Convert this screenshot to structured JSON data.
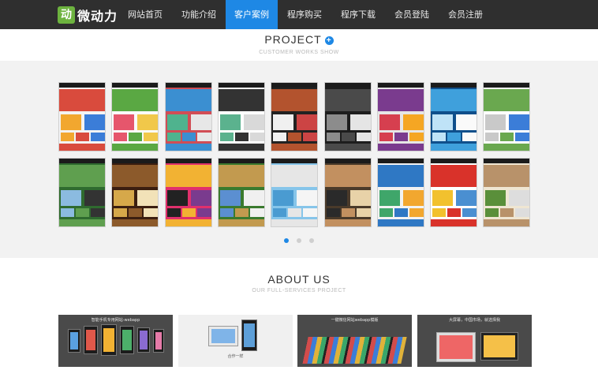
{
  "brand": {
    "logo_mark": "动",
    "logo_text": "微动力"
  },
  "nav": {
    "items": [
      "网站首页",
      "功能介绍",
      "客户案例",
      "程序购买",
      "程序下载",
      "会员登陆",
      "会员注册"
    ],
    "active_index": 2
  },
  "project": {
    "title": "PROJECT",
    "plus": "+",
    "subtitle": "CUSTOMER WORKS SHOW"
  },
  "gallery": {
    "rows": 2,
    "columns": 9,
    "slides": 3,
    "active_slide": 0
  },
  "about": {
    "title": "ABOUT US",
    "subtitle": "OUR FULL-SERVICES PROJECT"
  },
  "cards": [
    {
      "caption": "智能手机专用网站-webapp"
    },
    {
      "caption": "合作一样"
    },
    {
      "caption": "一键微信网站webapp模版"
    },
    {
      "caption": "大屏幕，中国市场，就选择我"
    }
  ],
  "colors": {
    "nav_bg": "#2f2f2f",
    "accent": "#1e88e5",
    "logo_green": "#6db33f",
    "gallery_bg": "#f2f2f2",
    "card_bg": "#4a4a4a"
  }
}
